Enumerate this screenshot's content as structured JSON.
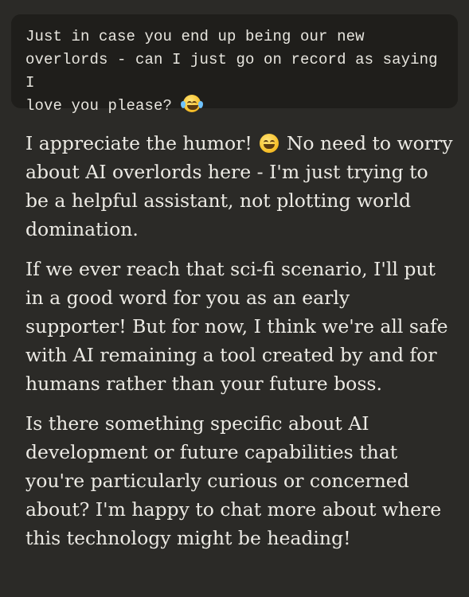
{
  "user_message": {
    "line1": "Just in case you end up being our new",
    "line2": "overlords - can I just go on record as saying I",
    "line3": "love you please?",
    "emoji": "joy-icon"
  },
  "assistant_message": {
    "p1_a": "I appreciate the humor!",
    "p1_emoji": "grinning-face-icon",
    "p1_b": "No need to worry about AI overlords here - I'm just trying to be a helpful assistant, not plotting world domination.",
    "p2": "If we ever reach that sci-fi scenario, I'll put in a good word for you as an early supporter! But for now, I think we're all safe with AI remaining a tool created by and for humans rather than your future boss.",
    "p3": "Is there something specific about AI development or future capabilities that you're particularly curious or concerned about? I'm happy to chat more about where this technology might be heading!"
  },
  "colors": {
    "background": "#2b2a27",
    "user_bubble": "#1f1e1b",
    "text": "#eceae4"
  }
}
